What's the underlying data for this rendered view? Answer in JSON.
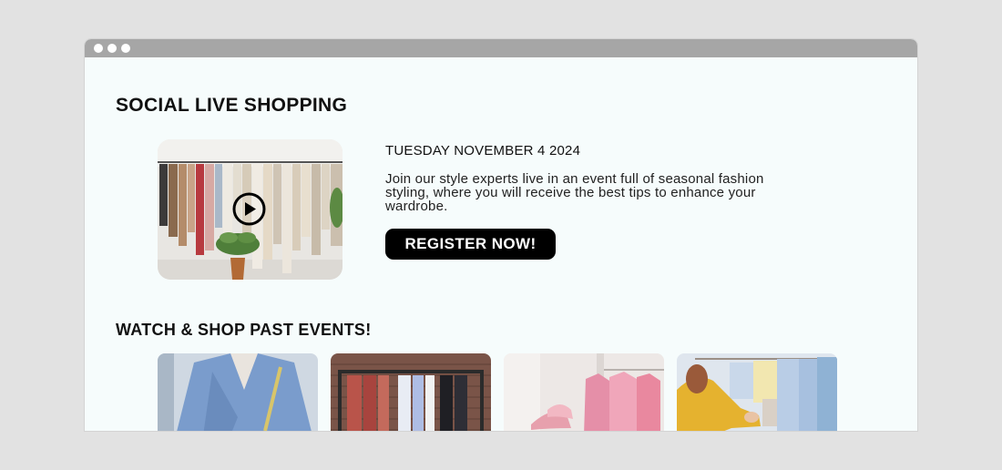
{
  "page": {
    "live_section_title": "SOCIAL LIVE SHOPPING",
    "event": {
      "date": "TUESDAY NOVEMBER 4 2024",
      "description": "Join our style experts live in an event full of seasonal fashion styling, where you will receive the best tips to enhance your wardrobe.",
      "register_label": "REGISTER NOW!"
    },
    "past_section_title": "WATCH & SHOP PAST EVENTS!",
    "past_events": [
      {
        "icon": "blue-blazer-photo"
      },
      {
        "icon": "clothing-rack-brick-photo"
      },
      {
        "icon": "pink-shirts-photo"
      },
      {
        "icon": "yellow-jacket-shopper-photo"
      }
    ]
  },
  "colors": {
    "background": "#e2e2e2",
    "window": "#f6fcfc",
    "titlebar": "#a6a6a6",
    "button": "#000000"
  }
}
